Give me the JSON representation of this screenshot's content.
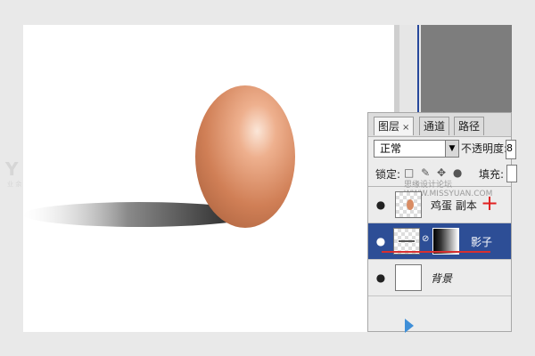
{
  "watermark": {
    "logo": "Y",
    "sub": "业 余"
  },
  "panel": {
    "tabs": [
      {
        "label": "图层",
        "close": "×"
      },
      {
        "label": "通道"
      },
      {
        "label": "路径"
      }
    ],
    "blend_mode": "正常",
    "opacity_label": "不透明度:",
    "opacity_value": "8",
    "lock_label": "锁定:",
    "lock_icons": "□ ✎ ✥ ●",
    "fill_label": "填充:",
    "site_mark": "思缘设计论坛 WWW.MISSYUAN.COM",
    "layers": [
      {
        "name": "鸡蛋 副本",
        "eye": "●",
        "selected": false
      },
      {
        "name": "影子",
        "eye": "●",
        "selected": true
      },
      {
        "name": "背景",
        "eye": "●",
        "selected": false
      }
    ],
    "plus_mark": "+"
  },
  "colors": {
    "selected_layer": "#2d4e96",
    "egg": "#d98c63",
    "annotation": "#e02020"
  }
}
